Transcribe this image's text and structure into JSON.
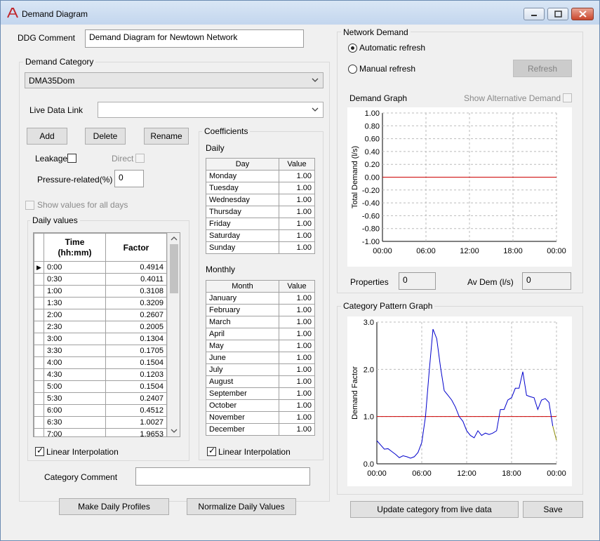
{
  "window": {
    "title": "Demand Diagram"
  },
  "ddg_comment": {
    "label": "DDG Comment",
    "value": "Demand Diagram for Newtown Network"
  },
  "demand_category": {
    "group_title": "Demand Category",
    "selected": "DMA35Dom",
    "live_data_link_label": "Live Data Link",
    "live_data_link_value": ""
  },
  "buttons": {
    "add": "Add",
    "delete": "Delete",
    "rename": "Rename",
    "make_daily_profiles": "Make Daily Profiles",
    "normalize_daily_values": "Normalize Daily Values",
    "refresh": "Refresh",
    "update_category": "Update category from live data",
    "save": "Save"
  },
  "options": {
    "leakage": "Leakage",
    "direct": "Direct",
    "pressure_related_label": "Pressure-related(%)",
    "pressure_related_value": "0",
    "show_values_all_days": "Show values for all days",
    "linear_interpolation": "Linear Interpolation"
  },
  "daily_values": {
    "title": "Daily values",
    "col_time": "Time",
    "col_time_unit": "(hh:mm)",
    "col_factor": "Factor",
    "rows": [
      {
        "time": "0:00",
        "factor": "0.4914"
      },
      {
        "time": "0:30",
        "factor": "0.4011"
      },
      {
        "time": "1:00",
        "factor": "0.3108"
      },
      {
        "time": "1:30",
        "factor": "0.3209"
      },
      {
        "time": "2:00",
        "factor": "0.2607"
      },
      {
        "time": "2:30",
        "factor": "0.2005"
      },
      {
        "time": "3:00",
        "factor": "0.1304"
      },
      {
        "time": "3:30",
        "factor": "0.1705"
      },
      {
        "time": "4:00",
        "factor": "0.1504"
      },
      {
        "time": "4:30",
        "factor": "0.1203"
      },
      {
        "time": "5:00",
        "factor": "0.1504"
      },
      {
        "time": "5:30",
        "factor": "0.2407"
      },
      {
        "time": "6:00",
        "factor": "0.4512"
      },
      {
        "time": "6:30",
        "factor": "1.0027"
      },
      {
        "time": "7:00",
        "factor": "1.9653"
      }
    ]
  },
  "coefficients": {
    "title": "Coefficients",
    "daily_title": "Daily",
    "monthly_title": "Monthly",
    "col_day": "Day",
    "col_month": "Month",
    "col_value": "Value",
    "daily": [
      {
        "name": "Monday",
        "value": "1.00"
      },
      {
        "name": "Tuesday",
        "value": "1.00"
      },
      {
        "name": "Wednesday",
        "value": "1.00"
      },
      {
        "name": "Thursday",
        "value": "1.00"
      },
      {
        "name": "Friday",
        "value": "1.00"
      },
      {
        "name": "Saturday",
        "value": "1.00"
      },
      {
        "name": "Sunday",
        "value": "1.00"
      }
    ],
    "monthly": [
      {
        "name": "January",
        "value": "1.00"
      },
      {
        "name": "February",
        "value": "1.00"
      },
      {
        "name": "March",
        "value": "1.00"
      },
      {
        "name": "April",
        "value": "1.00"
      },
      {
        "name": "May",
        "value": "1.00"
      },
      {
        "name": "June",
        "value": "1.00"
      },
      {
        "name": "July",
        "value": "1.00"
      },
      {
        "name": "August",
        "value": "1.00"
      },
      {
        "name": "September",
        "value": "1.00"
      },
      {
        "name": "October",
        "value": "1.00"
      },
      {
        "name": "November",
        "value": "1.00"
      },
      {
        "name": "December",
        "value": "1.00"
      }
    ]
  },
  "category_comment": {
    "label": "Category Comment",
    "value": ""
  },
  "network_demand": {
    "title": "Network Demand",
    "auto_refresh": "Automatic refresh",
    "manual_refresh": "Manual refresh",
    "demand_graph_label": "Demand Graph",
    "show_alternative": "Show Alternative Demand",
    "properties_label": "Properties",
    "properties_value": "0",
    "av_dem_label": "Av Dem (l/s)",
    "av_dem_value": "0"
  },
  "category_pattern": {
    "title": "Category Pattern Graph"
  },
  "colors": {
    "series": "#0000cc",
    "baseline": "#cc0000",
    "tail": "#8a8a00"
  },
  "chart_data": [
    {
      "type": "line",
      "ylabel": "Total Demand (l/s)",
      "xlabel": "",
      "ylim": [
        -1.0,
        1.0
      ],
      "yticks": [
        "1.00",
        "0.80",
        "0.60",
        "0.40",
        "0.20",
        "0.00",
        "-0.20",
        "-0.40",
        "-0.60",
        "-0.80",
        "-1.00"
      ],
      "xticks": [
        "00:00",
        "06:00",
        "12:00",
        "18:00",
        "00:00"
      ],
      "grid": true,
      "series": [
        {
          "x": [
            0,
            24
          ],
          "y": [
            0.0,
            0.0
          ]
        }
      ]
    },
    {
      "type": "line",
      "ylabel": "Demand Factor",
      "xlabel": "",
      "ylim": [
        0,
        3.0
      ],
      "yticks": [
        "3.0",
        "2.0",
        "1.0",
        "0.0"
      ],
      "xticks": [
        "00:00",
        "06:00",
        "12:00",
        "18:00",
        "00:00"
      ],
      "grid": true,
      "baseline": 1.0,
      "series": [
        {
          "x": [
            0,
            0.5,
            1,
            1.5,
            2,
            2.5,
            3,
            3.5,
            4,
            4.5,
            5,
            5.5,
            6,
            6.5,
            7,
            7.5,
            8,
            8.5,
            9,
            9.5,
            10,
            10.5,
            11,
            11.5,
            12,
            12.5,
            13,
            13.5,
            14,
            14.5,
            15,
            15.5,
            16,
            16.5,
            17,
            17.5,
            18,
            18.5,
            19,
            19.5,
            20,
            20.5,
            21,
            21.5,
            22,
            22.5,
            23,
            23.5,
            24
          ],
          "y": [
            0.49,
            0.4,
            0.31,
            0.32,
            0.26,
            0.2,
            0.13,
            0.17,
            0.15,
            0.12,
            0.15,
            0.24,
            0.45,
            1.0,
            1.97,
            2.85,
            2.65,
            2.05,
            1.55,
            1.45,
            1.35,
            1.2,
            1.0,
            0.9,
            0.7,
            0.6,
            0.55,
            0.7,
            0.6,
            0.65,
            0.62,
            0.65,
            0.7,
            1.15,
            1.15,
            1.35,
            1.4,
            1.6,
            1.6,
            1.95,
            1.45,
            1.42,
            1.4,
            1.15,
            1.35,
            1.38,
            1.3,
            0.8,
            0.5
          ]
        }
      ]
    }
  ]
}
